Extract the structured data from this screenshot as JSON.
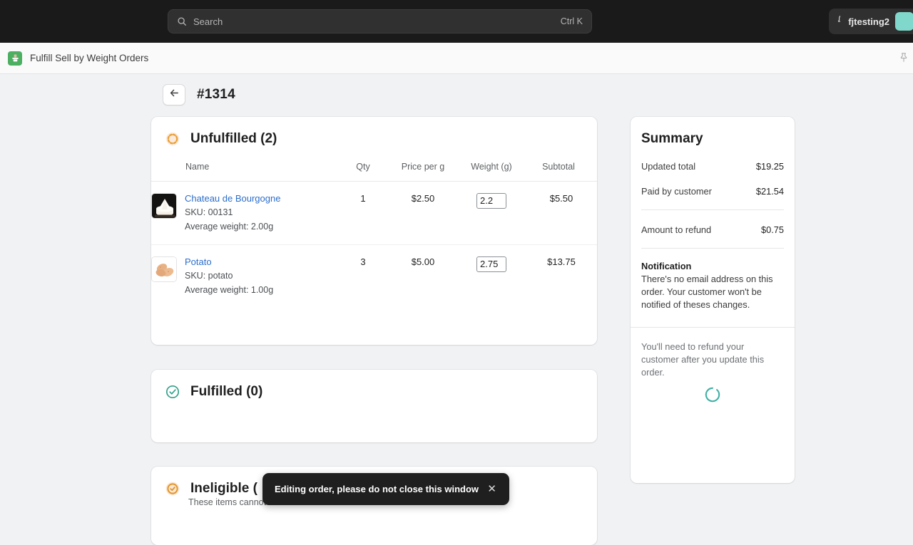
{
  "topbar": {
    "search_placeholder": "Search",
    "search_shortcut": "Ctrl K",
    "notifications_icon": "bell-icon",
    "user_name": "fjtesting2"
  },
  "appbar": {
    "app_icon": "scale-icon",
    "app_title": "Fulfill Sell by Weight Orders",
    "pin_icon": "pushpin-icon"
  },
  "page": {
    "back_icon": "arrow-left-icon",
    "order_id": "#1314"
  },
  "unfulfilled": {
    "status_icon": "incomplete-circle-icon",
    "title": "Unfulfilled (2)",
    "columns": {
      "name": "Name",
      "qty": "Qty",
      "price": "Price per g",
      "weight": "Weight (g)",
      "subtotal": "Subtotal"
    },
    "rows": [
      {
        "thumb": "cheese-wheel-image",
        "name": "Chateau de Bourgogne",
        "sku": "SKU: 00131",
        "avg_weight": "Average weight: 2.00g",
        "qty": "1",
        "price": "$2.50",
        "weight": "2.2",
        "subtotal": "$5.50"
      },
      {
        "thumb": "potato-image",
        "name": "Potato",
        "sku": "SKU: potato",
        "avg_weight": "Average weight: 1.00g",
        "qty": "3",
        "price": "$5.00",
        "weight": "2.75",
        "subtotal": "$13.75"
      }
    ]
  },
  "fulfilled": {
    "status_icon": "check-circle-green-icon",
    "title": "Fulfilled (0)"
  },
  "ineligible": {
    "status_icon": "check-circle-orange-icon",
    "title": "Ineligible (",
    "subtitle": "These items cannot"
  },
  "summary": {
    "title": "Summary",
    "rows": [
      {
        "label": "Updated total",
        "value": "$19.25"
      },
      {
        "label": "Paid by customer",
        "value": "$21.54"
      }
    ],
    "refund_row": {
      "label": "Amount to refund",
      "value": "$0.75"
    },
    "notification_title": "Notification",
    "notification_text": "There's no email address on this order. Your customer won't be notified of theses changes.",
    "footer_note": "You'll need to refund your customer after you update this order.",
    "spinner_icon": "loading-spinner-icon"
  },
  "toast": {
    "message": "Editing order, please do not close this window",
    "close_icon": "close-icon"
  },
  "colors": {
    "topbar_bg": "#1a1a1a",
    "page_bg": "#f1f2f4",
    "link": "#2c6ecb",
    "accent_green": "#4caf62",
    "accent_orange": "#e8a13a",
    "spinner_teal": "#3fb0a5",
    "avatar": "#7fd8cb"
  }
}
